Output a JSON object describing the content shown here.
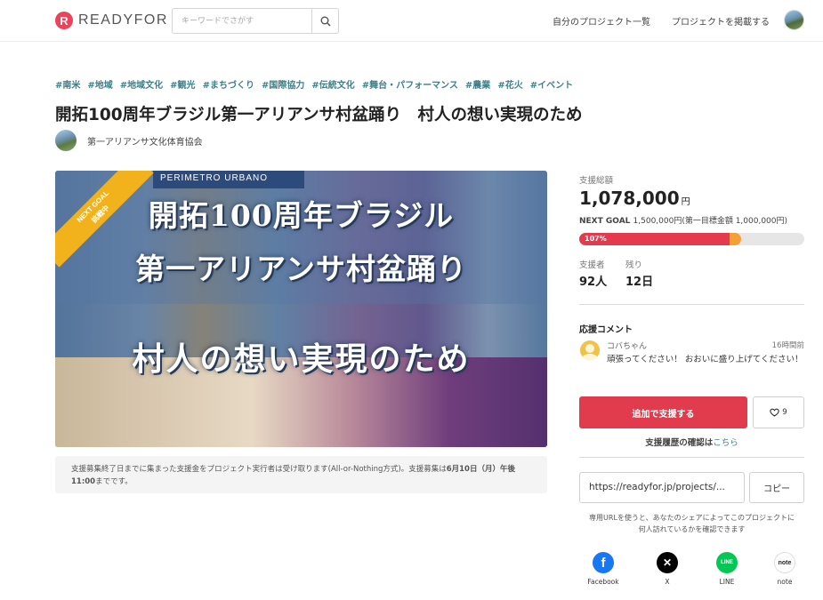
{
  "header": {
    "logo_mark": "R",
    "logo_text": "READYFOR",
    "search_placeholder": "キーワードでさがす",
    "nav_my_projects": "自分のプロジェクト一覧",
    "nav_post_project": "プロジェクトを掲載する"
  },
  "project": {
    "tags": [
      "#南米",
      "#地域",
      "#地域文化",
      "#観光",
      "#まちづくり",
      "#国際協力",
      "#伝統文化",
      "#舞台・パフォーマンス",
      "#農業",
      "#花火",
      "#イベント"
    ],
    "title": "開拓100周年ブラジル第一アリアンサ村盆踊り　村人の想い実現のため",
    "owner": "第一アリアンサ文化体育協会",
    "hero": {
      "corner_ribbon_l1": "NEXT GOAL",
      "corner_ribbon_l2": "挑戦中",
      "sign_text": "PERIMETRO URBANO",
      "line1": "開拓100周年ブラジル",
      "line2": "第一アリアンサ村盆踊り",
      "line3": "村人の想い実現のため"
    },
    "notice_prefix": "支援募集終了日までに集まった支援金をプロジェクト実行者は受け取ります(All-or-Nothing方式)。支援募集は",
    "notice_bold": "6月10日（月）午後11:00",
    "notice_suffix": "までです。"
  },
  "stats": {
    "total_label": "支援総額",
    "total_amount": "1,078,000",
    "currency": "円",
    "next_goal_prefix": "NEXT GOAL ",
    "next_goal_value": "1,500,000円(第一目標金額 1,000,000円)",
    "progress_label": "107%",
    "progress_percent": 107,
    "progress_next_goal_fraction": 0.7187,
    "progress_first_goal_fraction": 0.6667,
    "supporters_label": "支援者",
    "supporters_value": "92人",
    "remaining_label": "残り",
    "remaining_value": "12日"
  },
  "comments": {
    "section_title": "応援コメント",
    "items": [
      {
        "name": "コバちゃん",
        "time": "16時間前",
        "text": "頑張ってください！ おおいに盛り上げてください！"
      }
    ]
  },
  "actions": {
    "support_button": "追加で支援する",
    "favorite_count": "9",
    "history_prefix": "支援履歴の確認は",
    "history_link": "こちら",
    "share_url": "https://readyfor.jp/projects/...",
    "copy_button": "コピー",
    "url_note": "専用URLを使うと、あなたのシェアによってこのプロジェクトに何人訪れているかを確認できます"
  },
  "share": [
    {
      "name": "Facebook",
      "icon": "facebook-icon",
      "color": "#1877f2",
      "glyph": "f"
    },
    {
      "name": "X",
      "icon": "x-icon",
      "color": "#000000",
      "glyph": "𝕏"
    },
    {
      "name": "LINE",
      "icon": "line-icon",
      "color": "#06c755",
      "glyph": "LINE"
    },
    {
      "name": "note",
      "icon": "note-icon",
      "color": "#ffffff",
      "glyph": "note"
    }
  ],
  "colors": {
    "accent": "#e13c4d",
    "tag": "#3f7f86",
    "progress_primary": "#e5394e",
    "progress_secondary": "#f5a037",
    "ribbon": "#f2b21b"
  }
}
